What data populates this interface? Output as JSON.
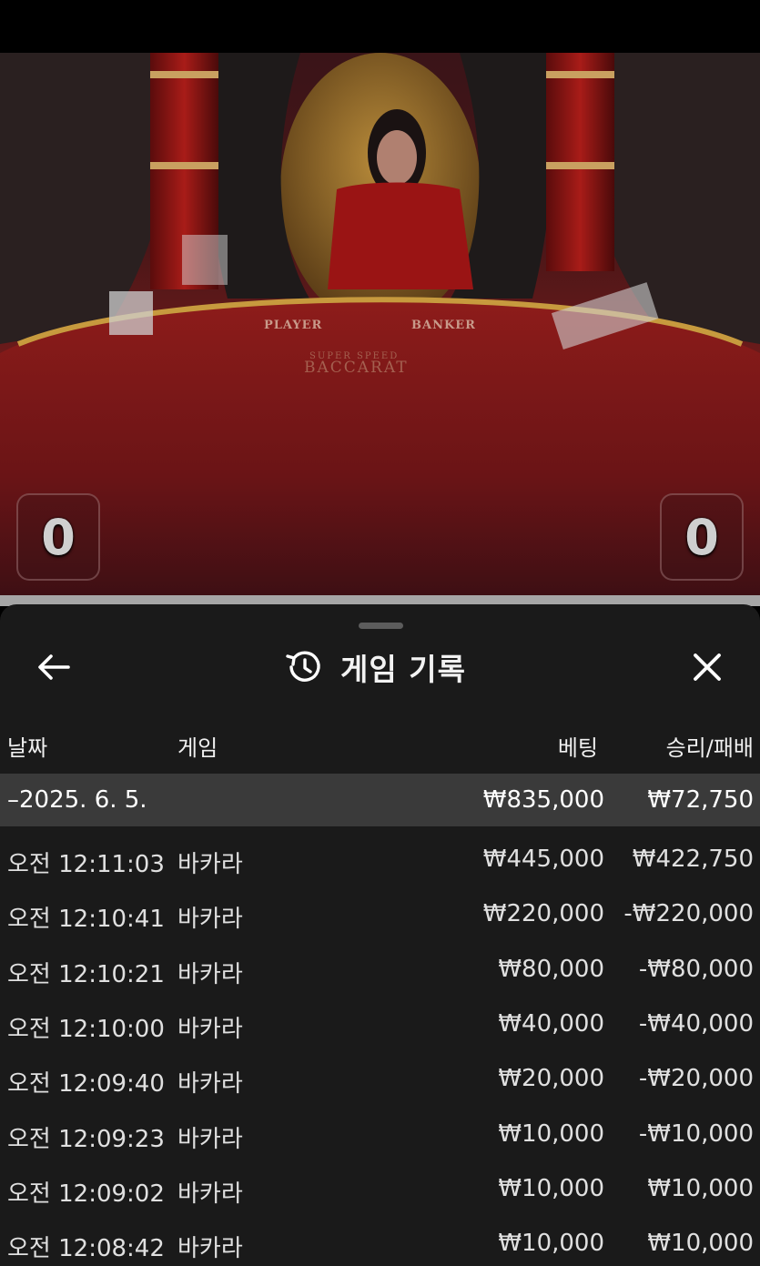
{
  "video": {
    "table_labels": {
      "player": "PLAYER",
      "banker": "BANKER"
    },
    "brand_small": "SUPER SPEED",
    "brand_large": "BACCARAT",
    "player_score": "0",
    "banker_score": "0"
  },
  "panel": {
    "title": "게임 기록",
    "icons": {
      "back": "arrow-left-icon",
      "history": "history-icon",
      "close": "close-icon"
    }
  },
  "columns": {
    "date": "날짜",
    "game": "게임",
    "bet": "베팅",
    "result": "승리/패배"
  },
  "summary": {
    "date": "–2025. 6. 5.",
    "bet": "₩835,000",
    "result": "₩72,750"
  },
  "rows": [
    {
      "time": "오전 12:11:03",
      "game": "바카라",
      "bet": "₩445,000",
      "result": "₩422,750"
    },
    {
      "time": "오전 12:10:41",
      "game": "바카라",
      "bet": "₩220,000",
      "result": "-₩220,000"
    },
    {
      "time": "오전 12:10:21",
      "game": "바카라",
      "bet": "₩80,000",
      "result": "-₩80,000"
    },
    {
      "time": "오전 12:10:00",
      "game": "바카라",
      "bet": "₩40,000",
      "result": "-₩40,000"
    },
    {
      "time": "오전 12:09:40",
      "game": "바카라",
      "bet": "₩20,000",
      "result": "-₩20,000"
    },
    {
      "time": "오전 12:09:23",
      "game": "바카라",
      "bet": "₩10,000",
      "result": "-₩10,000"
    },
    {
      "time": "오전 12:09:02",
      "game": "바카라",
      "bet": "₩10,000",
      "result": "₩10,000"
    },
    {
      "time": "오전 12:08:42",
      "game": "바카라",
      "bet": "₩10,000",
      "result": "₩10,000"
    }
  ]
}
